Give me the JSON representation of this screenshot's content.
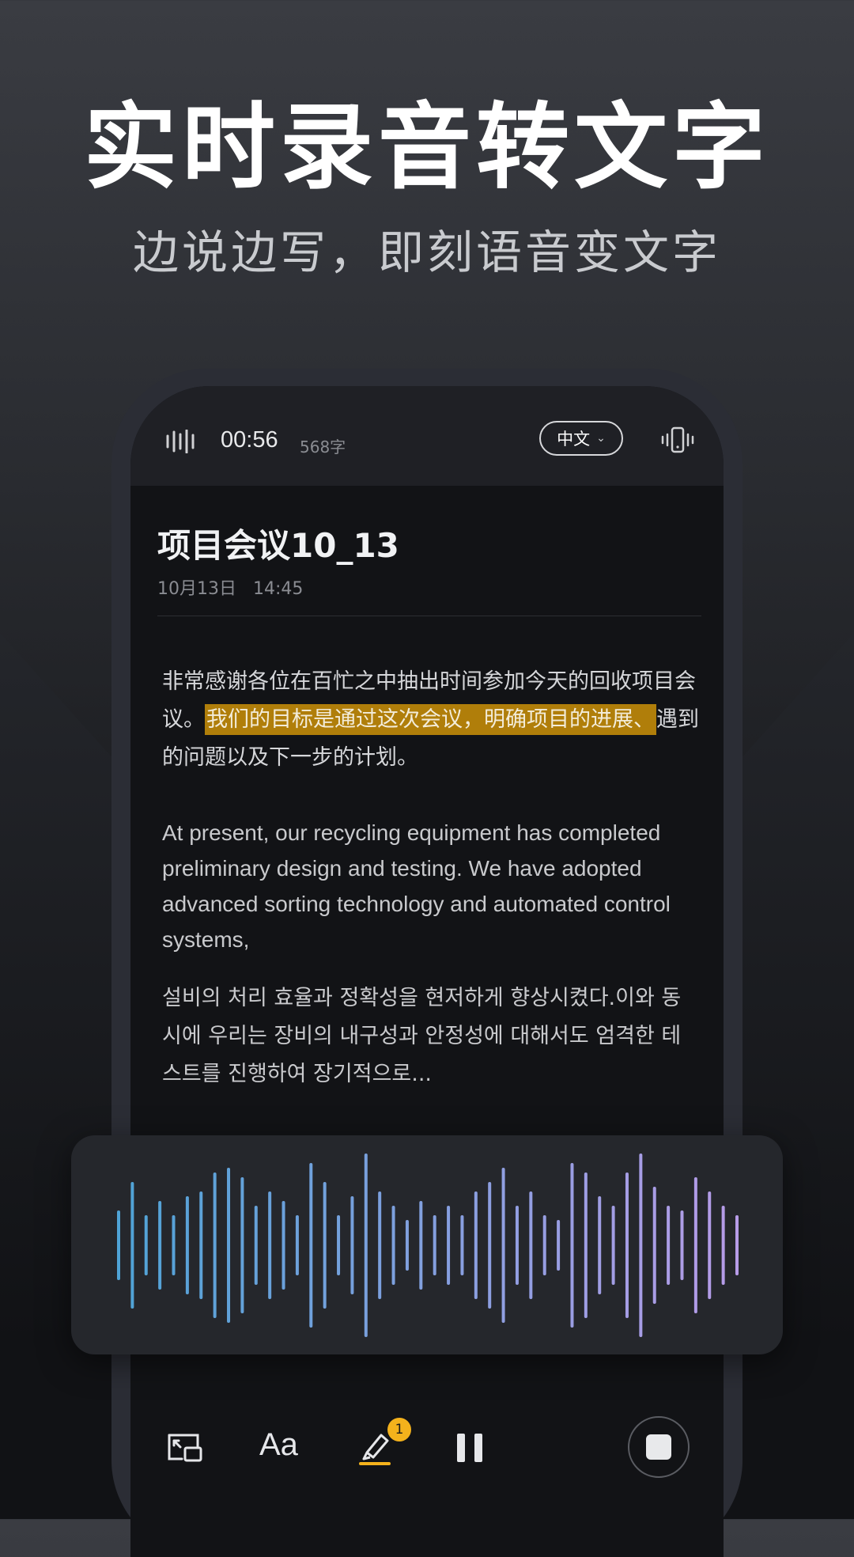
{
  "hero": {
    "title": "实时录音转文字",
    "subtitle": "边说边写，即刻语音变文字"
  },
  "status_bar": {
    "timer": "00:56",
    "word_count": "568字",
    "language": "中文",
    "icons": [
      "waveform-icon",
      "chevron-down-icon",
      "vibrate-phone-icon"
    ]
  },
  "document": {
    "title": "项目会议10_13",
    "date": "10月13日",
    "time": "14:45",
    "para1_before": "非常感谢各位在百忙之中抽出时间参加今天的回收项目会议。",
    "para1_highlight": "我们的目标是通过这次会议，明确项目的进展、",
    "para1_after": "遇到的问题以及下一步的计划。",
    "para2": "At present, our recycling equipment has completed preliminary design and testing. We have adopted advanced sorting technology and automated control systems,",
    "para3": "설비의 처리 효율과 정확성을 현저하게 향상시켰다.이와 동시에 우리는 장비의 내구성과 안정성에 대해서도 엄격한 테스트를 진행하여 장기적으로..."
  },
  "waveform": {
    "levels": [
      0.35,
      0.65,
      0.3,
      0.45,
      0.3,
      0.5,
      0.55,
      0.75,
      0.8,
      0.7,
      0.4,
      0.55,
      0.45,
      0.3,
      0.85,
      0.65,
      0.3,
      0.5,
      0.95,
      0.55,
      0.4,
      0.25,
      0.45,
      0.3,
      0.4,
      0.3,
      0.55,
      0.65,
      0.8,
      0.4,
      0.55,
      0.3,
      0.25,
      0.85,
      0.75,
      0.5,
      0.4,
      0.75,
      0.95,
      0.6,
      0.4,
      0.35,
      0.7,
      0.55,
      0.4,
      0.3
    ],
    "gradient_start": "#4fa3d6",
    "gradient_end": "#b79ce8"
  },
  "toolbar": {
    "icons": [
      "picture-in-picture-icon",
      "font-size-icon",
      "highlighter-icon",
      "pause-icon",
      "stop-icon"
    ],
    "font_label": "Aa",
    "highlight_badge": "1"
  },
  "colors": {
    "highlight": "#b07e0a",
    "badge": "#f4b21c"
  }
}
